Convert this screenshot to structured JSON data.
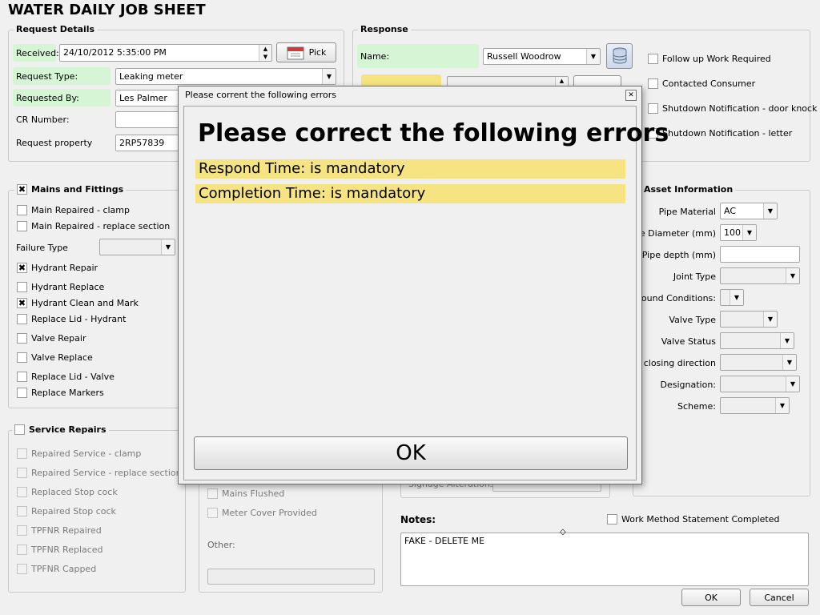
{
  "window": {
    "title": "WATER DAILY JOB SHEET"
  },
  "request": {
    "title": "Request Details",
    "received_label": "Received:",
    "received_value": "24/10/2012 5:35:00 PM",
    "pick_label": "Pick",
    "type_label": "Request Type:",
    "type_value": "Leaking meter",
    "by_label": "Requested By:",
    "by_value": "Les Palmer",
    "cr_label": "CR Number:",
    "cr_value": "",
    "property_label": "Request property",
    "property_value": "2RP57839"
  },
  "response": {
    "title": "Response",
    "name_label": "Name:",
    "name_value": "Russell Woodrow",
    "checks": [
      {
        "label": "Follow up Work Required",
        "checked": false
      },
      {
        "label": "Contacted Consumer",
        "checked": false
      },
      {
        "label": "Shutdown Notification - door knock",
        "checked": false
      },
      {
        "label": "Shutdown Notification - letter",
        "checked": false
      }
    ]
  },
  "mains": {
    "title": "Mains and Fittings",
    "checked": true,
    "items": [
      {
        "label": "Main Repaired - clamp",
        "checked": false
      },
      {
        "label": "Main Repaired - replace section",
        "checked": false
      },
      {
        "label": "Hydrant Repair",
        "checked": true
      },
      {
        "label": "Hydrant Replace",
        "checked": false
      },
      {
        "label": "Hydrant Clean and Mark",
        "checked": true
      },
      {
        "label": "Replace Lid - Hydrant",
        "checked": false
      },
      {
        "label": "Valve Repair",
        "checked": false
      },
      {
        "label": "Valve Replace",
        "checked": false
      },
      {
        "label": "Replace Lid - Valve",
        "checked": false
      },
      {
        "label": "Replace Markers",
        "checked": false
      }
    ],
    "failure_label": "Failure Type",
    "failure_value": ""
  },
  "service": {
    "title": "Service Repairs",
    "checked": false,
    "items": [
      {
        "label": "Repaired Service - clamp"
      },
      {
        "label": "Repaired Service - replace section"
      },
      {
        "label": "Replaced Stop cock"
      },
      {
        "label": "Repaired Stop cock"
      },
      {
        "label": "TPFNR Repaired"
      },
      {
        "label": "TPFNR Replaced"
      },
      {
        "label": "TPFNR Capped"
      }
    ]
  },
  "middle": {
    "mains_flushed": "Mains Flushed",
    "meter_cover": "Meter Cover Provided",
    "other_label": "Other:",
    "signage_label": "Signage Alterations:"
  },
  "asset": {
    "title": "Asset Information",
    "rows": [
      {
        "label": "Pipe Material",
        "value": "AC"
      },
      {
        "label": "Pipe Diameter (mm)",
        "value": "100"
      },
      {
        "label": "Pipe depth (mm)",
        "value": ""
      },
      {
        "label": "Joint Type",
        "value": ""
      },
      {
        "label": "Ground Conditions:",
        "value": ""
      },
      {
        "label": "Valve Type",
        "value": ""
      },
      {
        "label": "Valve Status",
        "value": ""
      },
      {
        "label": "ve closing direction",
        "value": ""
      },
      {
        "label": "Designation:",
        "value": ""
      },
      {
        "label": "Scheme:",
        "value": ""
      }
    ]
  },
  "notes": {
    "label": "Notes:",
    "value": "FAKE - DELETE ME",
    "wms_label": "Work Method Statement Completed"
  },
  "footer": {
    "ok_label": "OK",
    "cancel_label": "Cancel"
  },
  "dialog": {
    "title": "Please corrent the following errors",
    "heading": "Please correct the following errors",
    "errors": [
      "Respond Time: is mandatory",
      "Completion Time: is mandatory"
    ],
    "ok_label": "OK",
    "close_glyph": "✕"
  },
  "colors": {
    "required": "#d5f5d5",
    "error": "#f6e483"
  }
}
